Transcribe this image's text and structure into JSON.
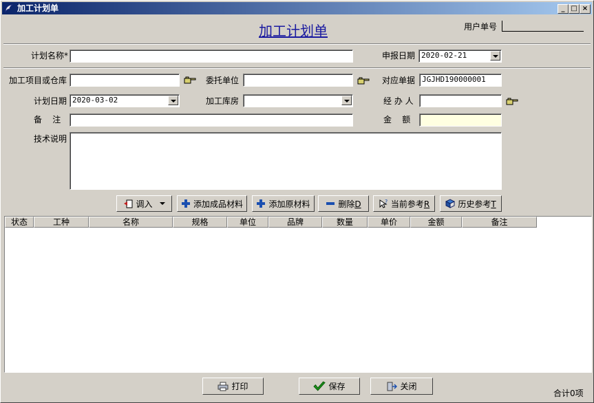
{
  "window": {
    "title": "加工计划单",
    "heading": "加工计划单",
    "user_order_label": "用户单号",
    "user_order_value": ""
  },
  "form": {
    "plan_name_label": "计划名称*",
    "plan_name_value": "",
    "report_date_label": "申报日期",
    "report_date_value": "2020-02-21",
    "project_label": "加工项目或仓库",
    "project_value": "",
    "entrust_label": "委托单位",
    "entrust_value": "",
    "related_doc_label": "对应单据",
    "related_doc_value": "JGJHD190000001",
    "plan_date_label": "计划日期",
    "plan_date_value": "2020-03-02",
    "warehouse_label": "加工库房",
    "warehouse_value": "",
    "handler_label": "经 办 人",
    "handler_value": "",
    "remark_label": "备    注",
    "remark_value": "",
    "amount_label": "金    额",
    "amount_value": "",
    "tech_label": "技术说明",
    "tech_value": ""
  },
  "toolbar": {
    "import_label": "调入",
    "add_product_label": "添加成品材料",
    "add_raw_label": "添加原材料",
    "delete_label": "删除",
    "delete_key": "D",
    "current_ref_label": "当前参考",
    "current_ref_key": "R",
    "history_ref_label": "历史参考",
    "history_ref_key": "T"
  },
  "table": {
    "columns": [
      "状态",
      "工种",
      "名称",
      "规格",
      "单位",
      "品牌",
      "数量",
      "单价",
      "金额",
      "备注"
    ],
    "rows": []
  },
  "footer": {
    "print_label": "打印",
    "save_label": "保存",
    "close_label": "关闭",
    "total_label": "合计0项"
  },
  "colors": {
    "heading": "#1a1aa0",
    "titlebar_start": "#0a246a",
    "titlebar_end": "#a6caf0",
    "face": "#d4d0c8",
    "amount_bg": "#ffffe1"
  }
}
